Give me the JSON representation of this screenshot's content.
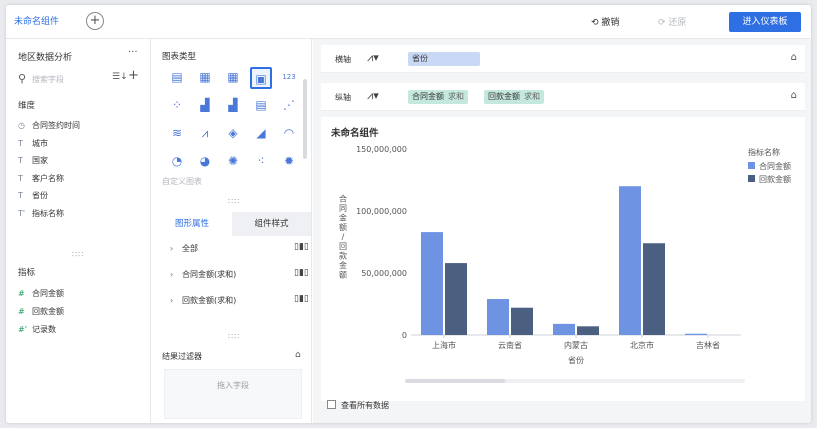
{
  "topbar": {
    "tab_title": "未命名组件",
    "undo_label": "撤销",
    "redo_label": "还原",
    "enter_dashboard": "进入仪表板"
  },
  "left_panel": {
    "dataset_title": "地区数据分析",
    "more_icon": "more-dots-icon",
    "search_placeholder": "搜索字段",
    "dimensions_label": "维度",
    "dimensions": [
      {
        "icon": "clock-icon",
        "glyph": "◷",
        "label": "合同签约时间"
      },
      {
        "icon": "text-field-icon",
        "glyph": "T",
        "label": "城市"
      },
      {
        "icon": "text-field-icon",
        "glyph": "T",
        "label": "国家"
      },
      {
        "icon": "text-field-icon",
        "glyph": "T",
        "label": "客户名称"
      },
      {
        "icon": "text-field-icon",
        "glyph": "T",
        "label": "省份"
      },
      {
        "icon": "text-field-icon",
        "glyph": "T'",
        "label": "指标名称"
      }
    ],
    "measures_label": "指标",
    "measures": [
      {
        "icon": "number-field-icon",
        "glyph": "#",
        "label": "合同金额"
      },
      {
        "icon": "number-field-icon",
        "glyph": "#",
        "label": "回款金额"
      },
      {
        "icon": "number-field-icon",
        "glyph": "#'",
        "label": "记录数"
      }
    ]
  },
  "middle_panel": {
    "chart_type_title": "图表类型",
    "custom_chart_label": "自定义图表",
    "tab_graph_attr": "图形属性",
    "tab_component_style": "组件样式",
    "attributes": [
      {
        "label": "全部"
      },
      {
        "label": "合同金额(求和)"
      },
      {
        "label": "回款金额(求和)"
      }
    ],
    "filter_title": "结果过滤器",
    "drop_placeholder": "拖入字段"
  },
  "axes": {
    "x_label": "横轴",
    "x_field": "省份",
    "y_label": "纵轴",
    "y_fields": [
      {
        "name": "合同金额",
        "agg": "求和"
      },
      {
        "name": "回款金额",
        "agg": "求和"
      }
    ]
  },
  "chart_card": {
    "title": "未命名组件",
    "view_all_label": "查看所有数据"
  },
  "colors": {
    "accent": "#2f6fe4",
    "series_contract": "#6f93e3",
    "series_payment": "#4b5f80",
    "highlight_box": "#e02020"
  },
  "chart_data": {
    "type": "bar",
    "categories": [
      "上海市",
      "云南省",
      "内蒙古",
      "北京市",
      "吉林省"
    ],
    "series": [
      {
        "name": "合同金额",
        "values": [
          83000000,
          29000000,
          9000000,
          120000000,
          1000000
        ]
      },
      {
        "name": "回款金额",
        "values": [
          58000000,
          22000000,
          7000000,
          74000000,
          0
        ]
      }
    ],
    "xlabel": "省份",
    "ylabel": "合同金额/回款金额",
    "ylim": [
      0,
      150000000
    ],
    "yticks": [
      "0",
      "50,000,000",
      "100,000,000",
      "150,000,000"
    ],
    "legend_title": "指标名称",
    "legend_position": "top-right"
  }
}
